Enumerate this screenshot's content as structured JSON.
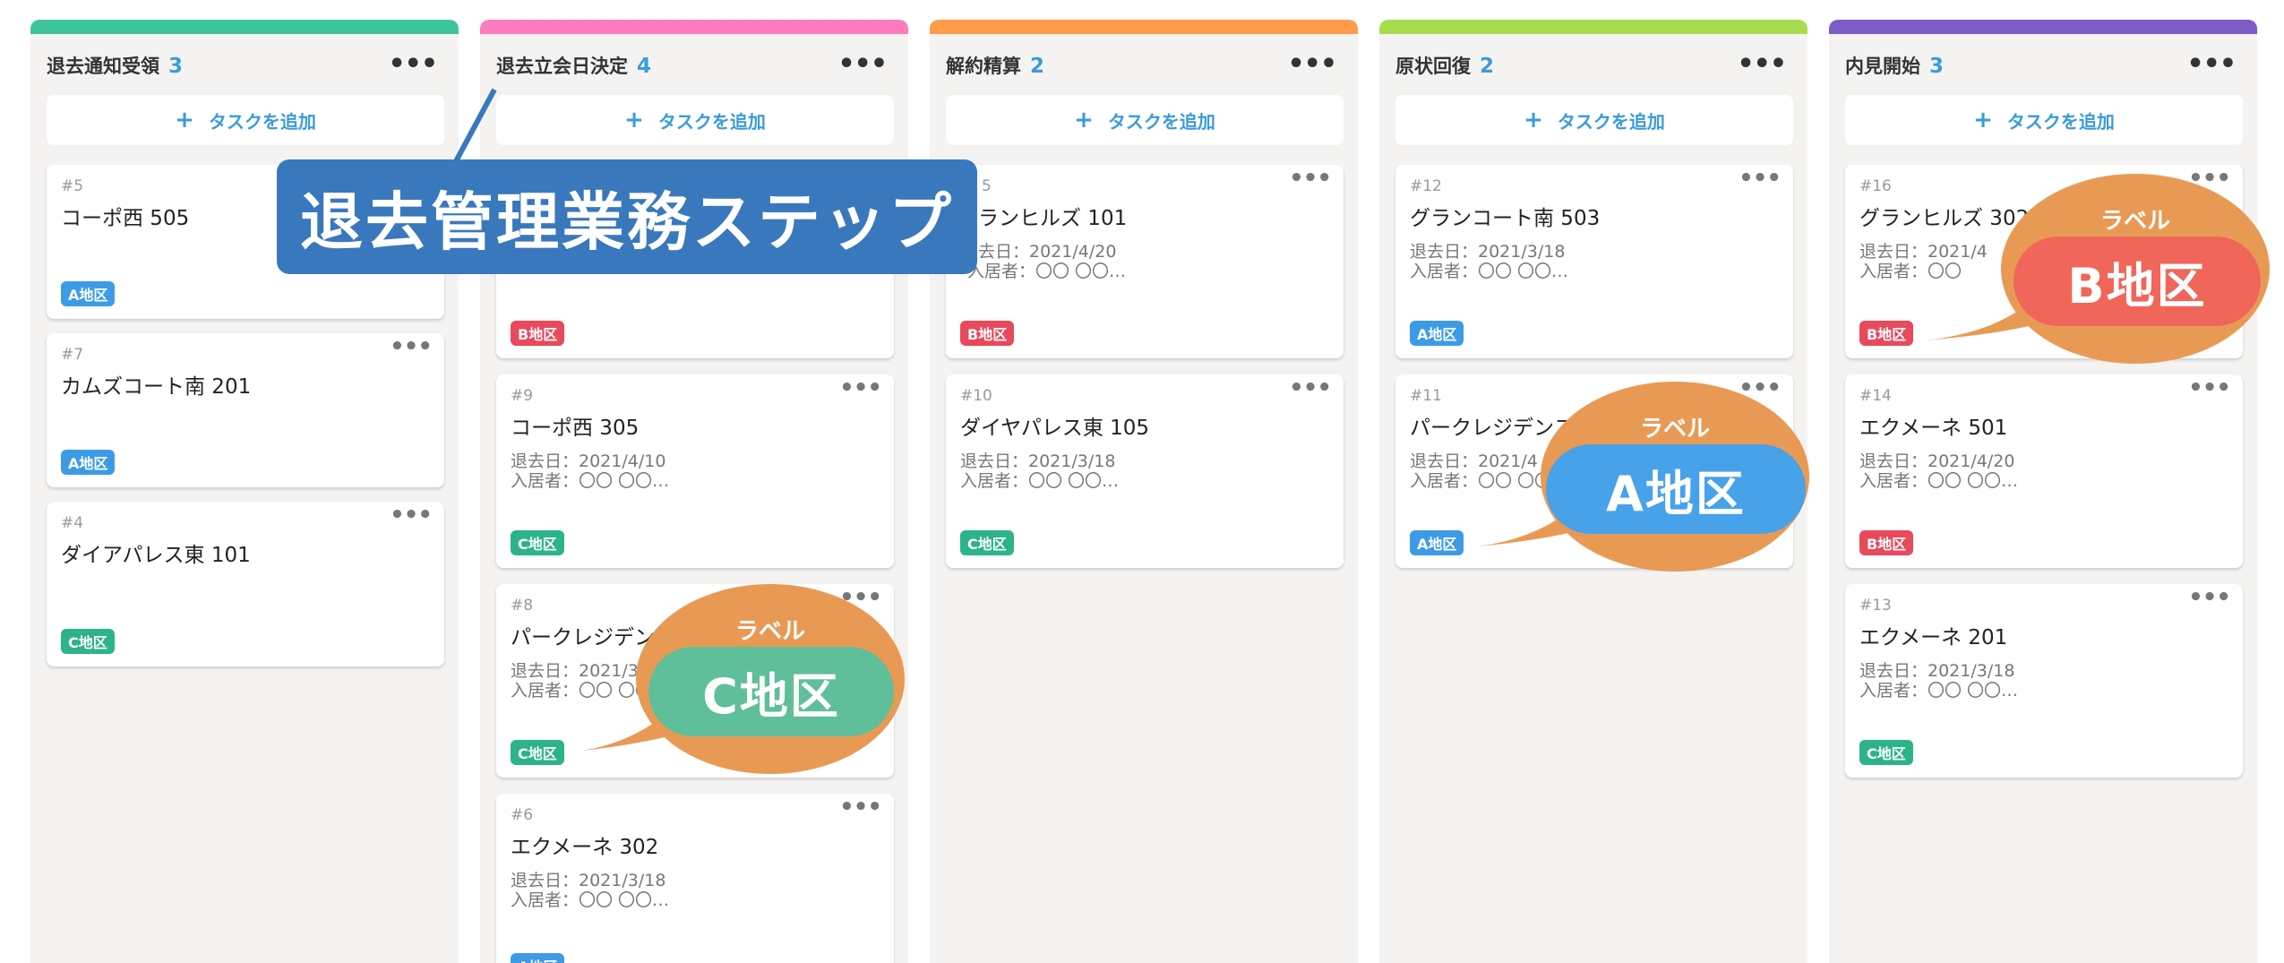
{
  "colors": {
    "tag_a": "#3d9be6",
    "tag_b": "#e8495c",
    "tag_c": "#2db389",
    "accent": "#3a9bdc",
    "banner": "#3a78bd",
    "bubble": "#e89a55"
  },
  "add_task_label": "タスクを追加",
  "columns": [
    {
      "name": "退去通知受領",
      "count": "3",
      "color": "#3ec49b",
      "cards": [
        {
          "num": "#5",
          "title": "コーポ西 505",
          "line1": "",
          "line2": "",
          "tag": "A地区",
          "tag_color": "#3d9be6"
        },
        {
          "num": "#7",
          "title": "カムズコート南 201",
          "line1": "",
          "line2": "",
          "tag": "A地区",
          "tag_color": "#3d9be6"
        },
        {
          "num": "#4",
          "title": "ダイアパレス東 101",
          "line1": "",
          "line2": "",
          "tag": "C地区",
          "tag_color": "#2db389"
        }
      ]
    },
    {
      "name": "退去立会日決定",
      "count": "4",
      "color": "#ff7bbf",
      "cards": [
        {
          "num": "",
          "title": "",
          "line1": "",
          "line2": "",
          "tag": "B地区",
          "tag_color": "#e8495c"
        },
        {
          "num": "#9",
          "title": "コーポ西 305",
          "line1": "退去日：2021/4/10",
          "line2": "入居者：〇〇 〇〇…",
          "tag": "C地区",
          "tag_color": "#2db389"
        },
        {
          "num": "#8",
          "title": "パークレジデンス",
          "line1": "退去日：2021/3",
          "line2": "入居者：〇〇 〇〇",
          "tag": "C地区",
          "tag_color": "#2db389"
        },
        {
          "num": "#6",
          "title": "エクメーネ 302",
          "line1": "退去日：2021/3/18",
          "line2": "入居者：〇〇 〇〇…",
          "tag": "A地区",
          "tag_color": "#3d9be6"
        }
      ]
    },
    {
      "name": "解約精算",
      "count": "2",
      "color": "#ff9b4a",
      "cards": [
        {
          "num": "5",
          "title": "ランヒルズ 101",
          "line1": "去日：2021/4/20",
          "line2": "入居者：〇〇 〇〇…",
          "tag": "B地区",
          "tag_color": "#e8495c"
        },
        {
          "num": "#10",
          "title": "ダイヤパレス東 105",
          "line1": "退去日：2021/3/18",
          "line2": "入居者：〇〇 〇〇…",
          "tag": "C地区",
          "tag_color": "#2db389"
        }
      ]
    },
    {
      "name": "原状回復",
      "count": "2",
      "color": "#a6dd4e",
      "cards": [
        {
          "num": "#12",
          "title": "グランコート南 503",
          "line1": "退去日：2021/3/18",
          "line2": "入居者：〇〇 〇〇…",
          "tag": "A地区",
          "tag_color": "#3d9be6"
        },
        {
          "num": "#11",
          "title": "パークレジデンス",
          "line1": "退去日：2021/4",
          "line2": "入居者：〇〇 〇〇",
          "tag": "A地区",
          "tag_color": "#3d9be6"
        }
      ]
    },
    {
      "name": "内見開始",
      "count": "3",
      "color": "#7e5bc6",
      "cards": [
        {
          "num": "#16",
          "title": "グランヒルズ 302",
          "line1": "退去日：2021/4",
          "line2": "入居者：〇〇",
          "tag": "B地区",
          "tag_color": "#e8495c"
        },
        {
          "num": "#14",
          "title": "エクメーネ 501",
          "line1": "退去日：2021/4/20",
          "line2": "入居者：〇〇 〇〇…",
          "tag": "B地区",
          "tag_color": "#e8495c"
        },
        {
          "num": "#13",
          "title": "エクメーネ 201",
          "line1": "退去日：2021/3/18",
          "line2": "入居者：〇〇 〇〇…",
          "tag": "C地区",
          "tag_color": "#2db389"
        }
      ]
    }
  ],
  "annotations": {
    "banner": "退去管理業務ステップ",
    "bubble_label": "ラベル",
    "bubbles": [
      {
        "text": "C地区",
        "color": "#5fbf9a"
      },
      {
        "text": "A地区",
        "color": "#47a2ea"
      },
      {
        "text": "B地区",
        "color": "#f0665a"
      }
    ]
  }
}
